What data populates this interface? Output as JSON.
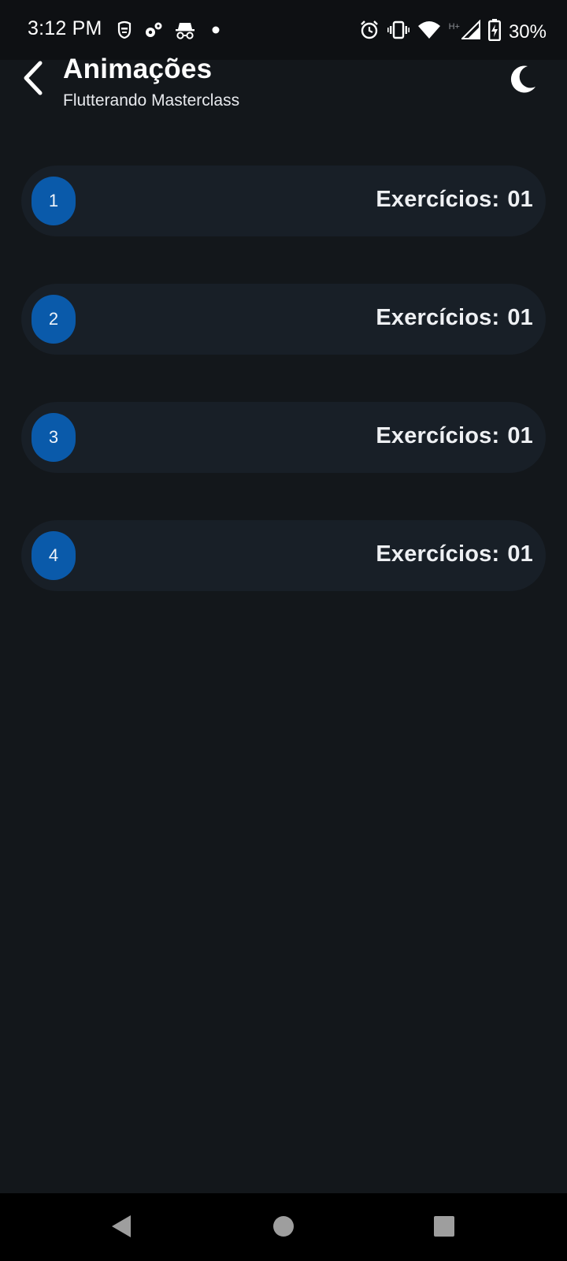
{
  "status_bar": {
    "time": "3:12 PM",
    "network_indicator": "H+",
    "battery": "30%",
    "icons_left": [
      "mask-icon",
      "settings-gears-icon",
      "incognito-icon",
      "dot-icon"
    ],
    "icons_right": [
      "alarm-icon",
      "vibrate-icon",
      "wifi-icon",
      "signal-icon",
      "battery-charging-icon"
    ]
  },
  "app_bar": {
    "title": "Animações",
    "subtitle": "Flutterando Masterclass",
    "back_icon": "chevron-left-icon",
    "theme_icon": "moon-icon"
  },
  "list": {
    "items": [
      {
        "number": "1",
        "label": "Exercícios:",
        "count": "01"
      },
      {
        "number": "2",
        "label": "Exercícios:",
        "count": "01"
      },
      {
        "number": "3",
        "label": "Exercícios:",
        "count": "01"
      },
      {
        "number": "4",
        "label": "Exercícios:",
        "count": "01"
      }
    ]
  },
  "nav_bar": {
    "icons": [
      "nav-back-icon",
      "nav-home-icon",
      "nav-recents-icon"
    ]
  },
  "colors": {
    "background": "#13171b",
    "card": "#181f27",
    "badge": "#0a5aaa",
    "status_bar": "#0e1013",
    "nav_bar": "#000000"
  }
}
